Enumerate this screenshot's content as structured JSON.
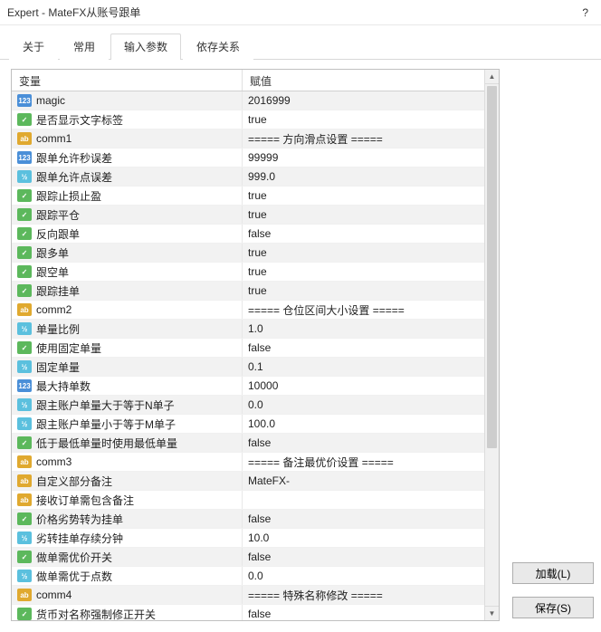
{
  "window": {
    "title": "Expert - MateFX从账号跟单",
    "help_label": "?"
  },
  "tabs": [
    {
      "label": "关于",
      "active": false
    },
    {
      "label": "常用",
      "active": false
    },
    {
      "label": "输入参数",
      "active": true
    },
    {
      "label": "依存关系",
      "active": false
    }
  ],
  "columns": {
    "variable": "变量",
    "value": "赋值"
  },
  "rows": [
    {
      "type": "int",
      "name": "magic",
      "value": "2016999"
    },
    {
      "type": "bool",
      "name": "是否显示文字标签",
      "value": "true"
    },
    {
      "type": "str",
      "name": "comm1",
      "value": "===== 方向滑点设置 ====="
    },
    {
      "type": "int",
      "name": "跟单允许秒误差",
      "value": "99999"
    },
    {
      "type": "dbl",
      "name": "跟单允许点误差",
      "value": "999.0"
    },
    {
      "type": "bool",
      "name": "跟踪止损止盈",
      "value": "true"
    },
    {
      "type": "bool",
      "name": "跟踪平仓",
      "value": "true"
    },
    {
      "type": "bool",
      "name": "反向跟单",
      "value": "false"
    },
    {
      "type": "bool",
      "name": "跟多单",
      "value": "true"
    },
    {
      "type": "bool",
      "name": "跟空单",
      "value": "true"
    },
    {
      "type": "bool",
      "name": "跟踪挂单",
      "value": "true"
    },
    {
      "type": "str",
      "name": "comm2",
      "value": "===== 仓位区间大小设置 ====="
    },
    {
      "type": "dbl",
      "name": "单量比例",
      "value": "1.0"
    },
    {
      "type": "bool",
      "name": "使用固定单量",
      "value": "false"
    },
    {
      "type": "dbl",
      "name": "固定单量",
      "value": "0.1"
    },
    {
      "type": "int",
      "name": "最大持单数",
      "value": "10000"
    },
    {
      "type": "dbl",
      "name": "跟主账户单量大于等于N单子",
      "value": "0.0"
    },
    {
      "type": "dbl",
      "name": "跟主账户单量小于等于M单子",
      "value": "100.0"
    },
    {
      "type": "bool",
      "name": "低于最低单量时使用最低单量",
      "value": "false"
    },
    {
      "type": "str",
      "name": "comm3",
      "value": "===== 备注最优价设置 ====="
    },
    {
      "type": "str",
      "name": "自定义部分备注",
      "value": "MateFX-"
    },
    {
      "type": "str",
      "name": "接收订单需包含备注",
      "value": ""
    },
    {
      "type": "bool",
      "name": "价格劣势转为挂单",
      "value": "false"
    },
    {
      "type": "dbl",
      "name": "劣转挂单存续分钟",
      "value": "10.0"
    },
    {
      "type": "bool",
      "name": "做单需优价开关",
      "value": "false"
    },
    {
      "type": "dbl",
      "name": "做单需优于点数",
      "value": "0.0"
    },
    {
      "type": "str",
      "name": "comm4",
      "value": "===== 特殊名称修改 ====="
    },
    {
      "type": "bool",
      "name": "货币对名称强制修正开关",
      "value": "false"
    }
  ],
  "buttons": {
    "load": "加载(L)",
    "save": "保存(S)"
  },
  "icon_text": {
    "int": "123",
    "bool": "✓",
    "str": "ab",
    "dbl": "½"
  }
}
